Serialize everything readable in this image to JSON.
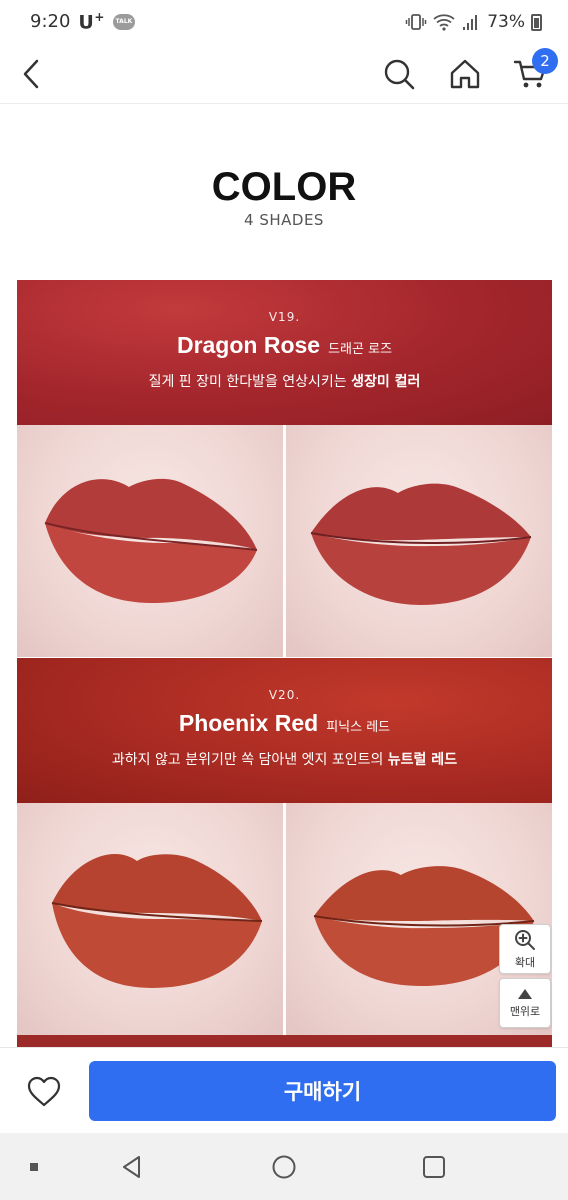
{
  "status_bar": {
    "time": "9:20",
    "carrier": "U",
    "carrier_sup": "+",
    "talk": "TALK",
    "battery": "73%"
  },
  "header": {
    "cart_count": "2"
  },
  "color_section": {
    "title": "COLOR",
    "subtitle": "4 SHADES"
  },
  "shades": [
    {
      "code": "V19.",
      "name": "Dragon Rose",
      "name_kr": "드래곤 로즈",
      "desc": "질게 핀 장미 한다발을 연상시키는 ",
      "desc_bold": "생장미 컬러",
      "lip_color": "#b5403d"
    },
    {
      "code": "V20.",
      "name": "Phoenix Red",
      "name_kr": "피닉스 레드",
      "desc": "과하지 않고 분위기만 쏙 담아낸 엣지 포인트의 ",
      "desc_bold": "뉴트럴 레드",
      "lip_color": "#b8432f"
    }
  ],
  "float_buttons": {
    "zoom_label": "확대",
    "top_label": "맨위로"
  },
  "bottom_bar": {
    "buy_label": "구매하기"
  },
  "colors": {
    "accent": "#2f6ef0",
    "banner_1": "#a3262c",
    "banner_2": "#a82a22"
  }
}
